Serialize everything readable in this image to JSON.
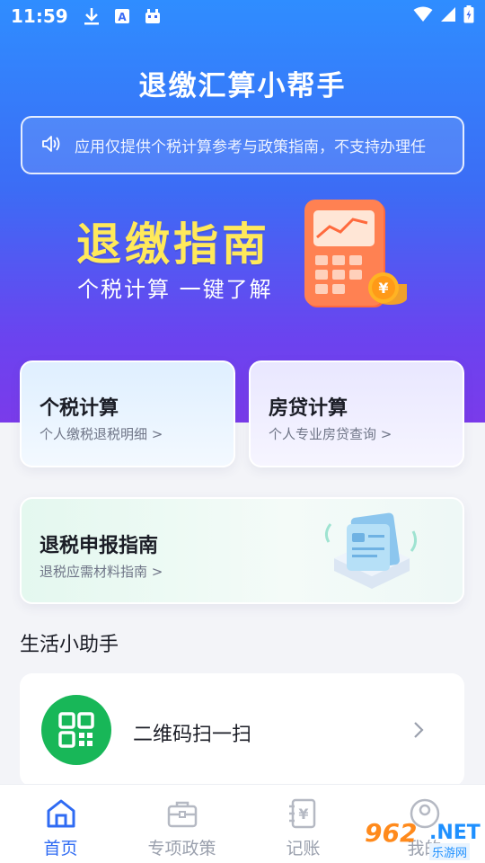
{
  "status_bar": {
    "time": "11:59"
  },
  "app": {
    "title": "退缴汇算小帮手"
  },
  "notice": {
    "text": "应用仅提供个税计算参考与政策指南，不支持办理任"
  },
  "banner": {
    "title": "退缴指南",
    "subtitle": "个税计算 一键了解"
  },
  "cards": {
    "tax": {
      "title": "个税计算",
      "subtitle": "个人缴税退税明细 >"
    },
    "loan": {
      "title": "房贷计算",
      "subtitle": "个人专业房贷查询 >"
    },
    "guide": {
      "title": "退税申报指南",
      "subtitle": "退税应需材料指南 >"
    }
  },
  "helper": {
    "section_title": "生活小助手",
    "scan_label": "二维码扫一扫"
  },
  "tabbar": [
    {
      "label": "首页",
      "active": true
    },
    {
      "label": "专项政策",
      "active": false
    },
    {
      "label": "记账",
      "active": false
    },
    {
      "label": "我的",
      "active": false
    }
  ],
  "watermark": {
    "num": "962",
    "net": ".NET",
    "sub": "乐游网"
  },
  "colors": {
    "accent": "#2f6bf3",
    "banner_yellow": "#ffe95a",
    "scan_green": "#18b758"
  }
}
